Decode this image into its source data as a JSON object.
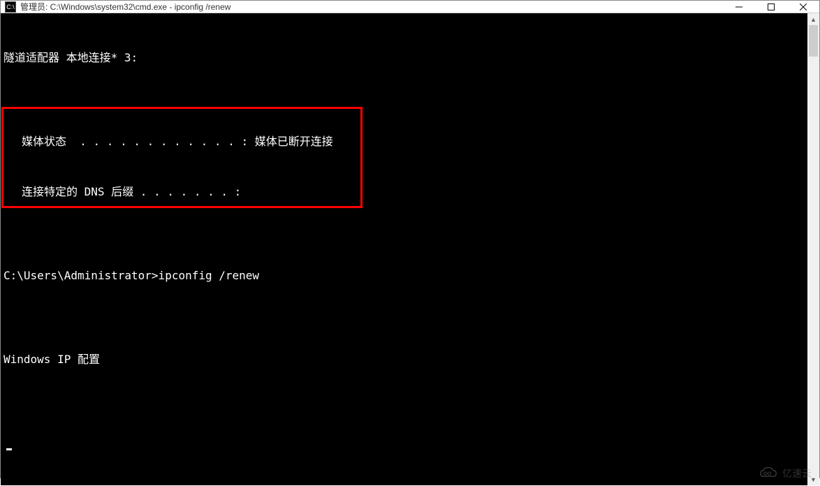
{
  "titlebar": {
    "icon_label": "cmd",
    "title": "管理员: C:\\Windows\\system32\\cmd.exe - ipconfig  /renew"
  },
  "terminal": {
    "line1": "隧道适配器 本地连接* 3:",
    "line2": "",
    "line3": "媒体状态  . . . . . . . . . . . . : 媒体已断开连接",
    "line4": "连接特定的 DNS 后缀 . . . . . . . :",
    "line5": "",
    "line6": "C:\\Users\\Administrator>ipconfig /renew",
    "line7": "",
    "line8": "Windows IP 配置",
    "line9": "",
    "line10": ""
  },
  "watermark": {
    "text": "亿速云"
  },
  "scrollbar": {
    "arrow_up": "▲",
    "arrow_down": "▼"
  }
}
